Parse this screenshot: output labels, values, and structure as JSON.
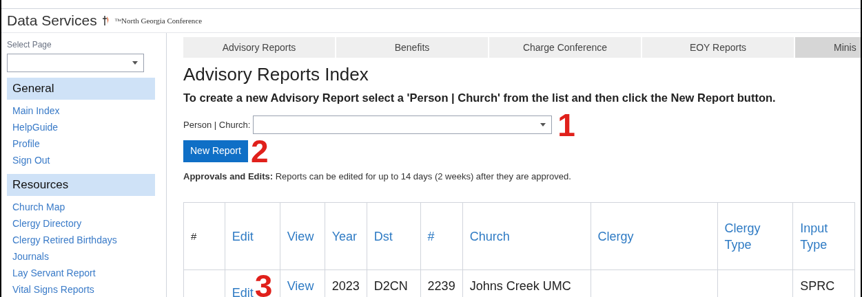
{
  "header": {
    "title": "Data Services",
    "org": "North Georgia Conference",
    "org_prefix": "The"
  },
  "sidebar": {
    "select_label": "Select Page",
    "sections": [
      {
        "title": "General",
        "items": [
          "Main Index",
          "HelpGuide",
          "Profile",
          "Sign Out"
        ]
      },
      {
        "title": "Resources",
        "items": [
          "Church Map",
          "Clergy Directory",
          "Clergy Retired Birthdays",
          "Journals",
          "Lay Servant Report",
          "Vital Signs Reports"
        ]
      }
    ]
  },
  "tabs": [
    {
      "label": "Advisory Reports",
      "selected": false
    },
    {
      "label": "Benefits",
      "selected": false
    },
    {
      "label": "Charge Conference",
      "selected": false
    },
    {
      "label": "EOY Reports",
      "selected": false
    },
    {
      "label": "Minis",
      "selected": true
    }
  ],
  "page": {
    "title": "Advisory Reports Index",
    "instruction": "To create a new Advisory Report select a 'Person | Church' from the list and then click the New Report button.",
    "field_label": "Person | Church:",
    "button": "New Report",
    "note": "**Approvals and Edits:** Reports can be edited for up to 14 days (2 weeks) after they are approved."
  },
  "annotations": [
    "1",
    "2",
    "3"
  ],
  "table": {
    "columns": [
      {
        "label": "#",
        "link": false
      },
      {
        "label": "Edit",
        "link": true
      },
      {
        "label": "View",
        "link": true
      },
      {
        "label": "Year",
        "link": true
      },
      {
        "label": "Dst",
        "link": true
      },
      {
        "label": "#",
        "link": true
      },
      {
        "label": "Church",
        "link": true
      },
      {
        "label": "Clergy",
        "link": true
      },
      {
        "label": "Clergy Type",
        "link": true
      },
      {
        "label": "Input Type",
        "link": true
      }
    ],
    "rows": [
      [
        "",
        "Edit",
        "View",
        "2023",
        "D2CN",
        "2239",
        "Johns Creek UMC",
        "",
        "",
        "SPRC"
      ]
    ]
  }
}
